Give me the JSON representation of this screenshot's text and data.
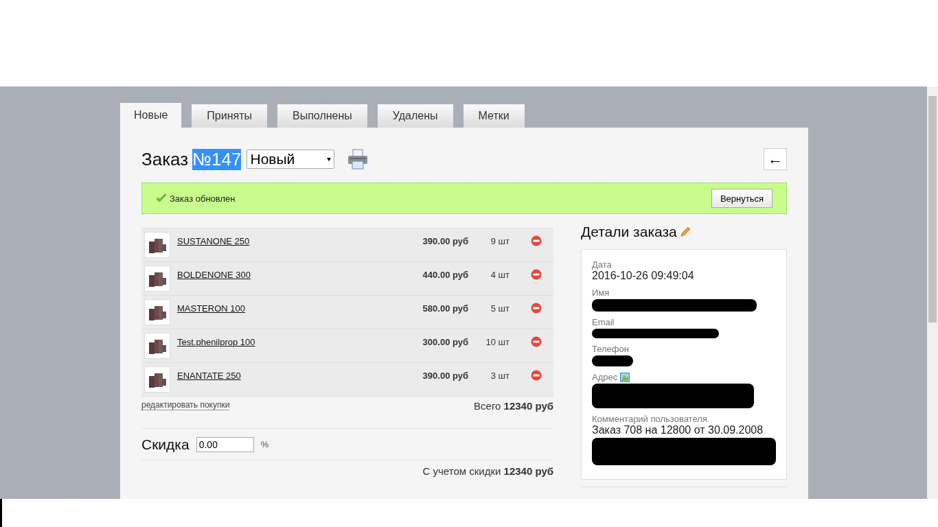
{
  "tabs": [
    {
      "label": "Новые",
      "selected": true
    },
    {
      "label": "Приняты",
      "selected": false
    },
    {
      "label": "Выполнены",
      "selected": false
    },
    {
      "label": "Удалены",
      "selected": false
    },
    {
      "label": "Метки",
      "selected": false
    }
  ],
  "order": {
    "title": "Заказ",
    "number": "№147",
    "number_highlighted": true,
    "status": "Новый",
    "back_button": "←"
  },
  "notice": {
    "text": "Заказ обновлен",
    "button": "Вернуться"
  },
  "items": [
    {
      "name": "SUSTANONE 250",
      "price": "390.00 руб",
      "qty": "9 шт"
    },
    {
      "name": "BOLDENONE 300",
      "price": "440.00 руб",
      "qty": "4 шт"
    },
    {
      "name": "MASTERON 100",
      "price": "580.00 руб",
      "qty": "5 шт"
    },
    {
      "name": "Test.phenilprop 100",
      "price": "300.00 руб",
      "qty": "10 шт"
    },
    {
      "name": "ENANTATE 250",
      "price": "390.00 руб",
      "qty": "3 шт"
    }
  ],
  "edit_link": "редактировать покупки",
  "total": {
    "label": "Всего",
    "value": "12340 руб"
  },
  "discount": {
    "label": "Скидка",
    "value": "0.00",
    "unit": "%"
  },
  "discounted_total": {
    "label": "С учетом скидки",
    "value": "12340 руб"
  },
  "details": {
    "title": "Детали заказа",
    "fields": [
      {
        "label": "Дата",
        "value": "2016-10-26 09:49:04",
        "redacted": false,
        "map_icon": false
      },
      {
        "label": "Имя",
        "redacted": true,
        "map_icon": false
      },
      {
        "label": "Email",
        "redacted": true,
        "map_icon": false
      },
      {
        "label": "Телефон",
        "redacted": true,
        "map_icon": false
      },
      {
        "label": "Адрес",
        "redacted": true,
        "map_icon": true
      },
      {
        "label": "Комментарий пользователя",
        "value": "Заказ 708 на 12800 от 30.09.2008",
        "redacted": true,
        "map_icon": false
      }
    ]
  }
}
